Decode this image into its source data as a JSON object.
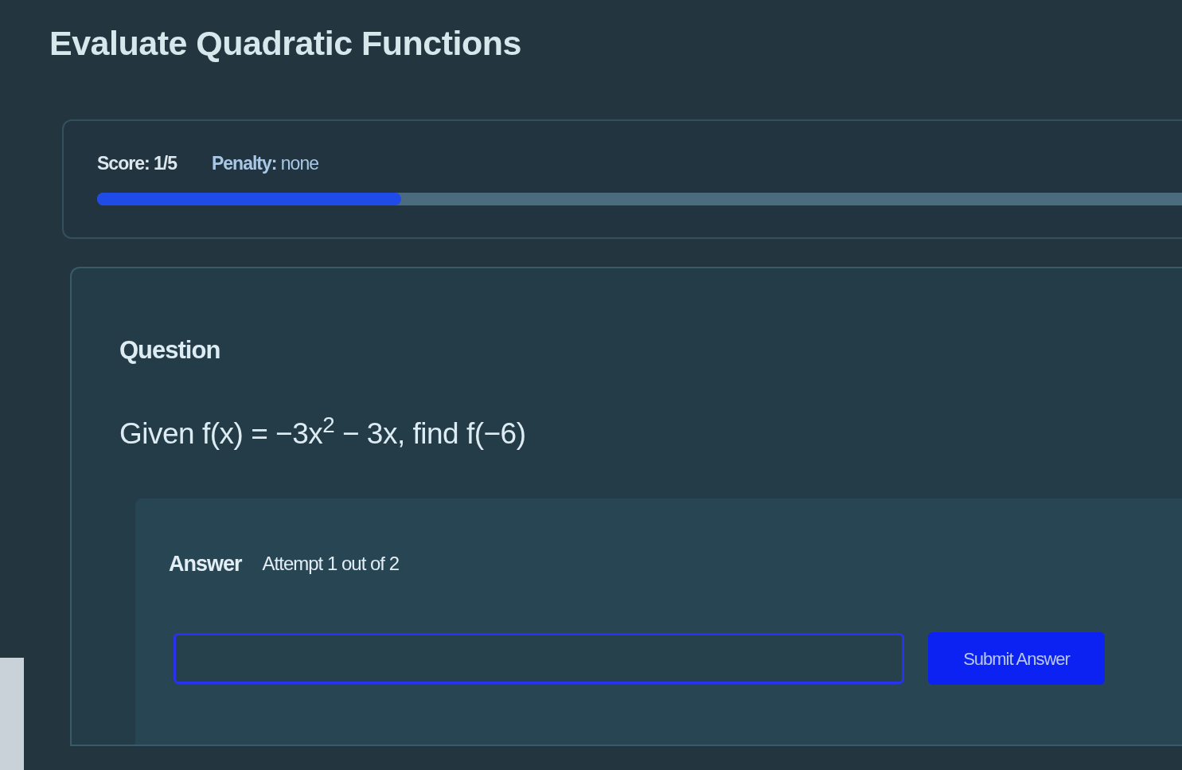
{
  "title": "Evaluate Quadratic Functions",
  "score_panel": {
    "score": "Score: 1/5",
    "penalty": "**Penalty:** none",
    "progress": {
      "level": 0.28
    }
  },
  "question": {
    "heading": "Question",
    "text": "Given f(x) = −3x$^{2}$ − 3x, find f(−6)"
  },
  "answer": {
    "heading": "Answer",
    "attempt": "Attempt 1 out of 2",
    "submit_button": "Submit Answer"
  }
}
